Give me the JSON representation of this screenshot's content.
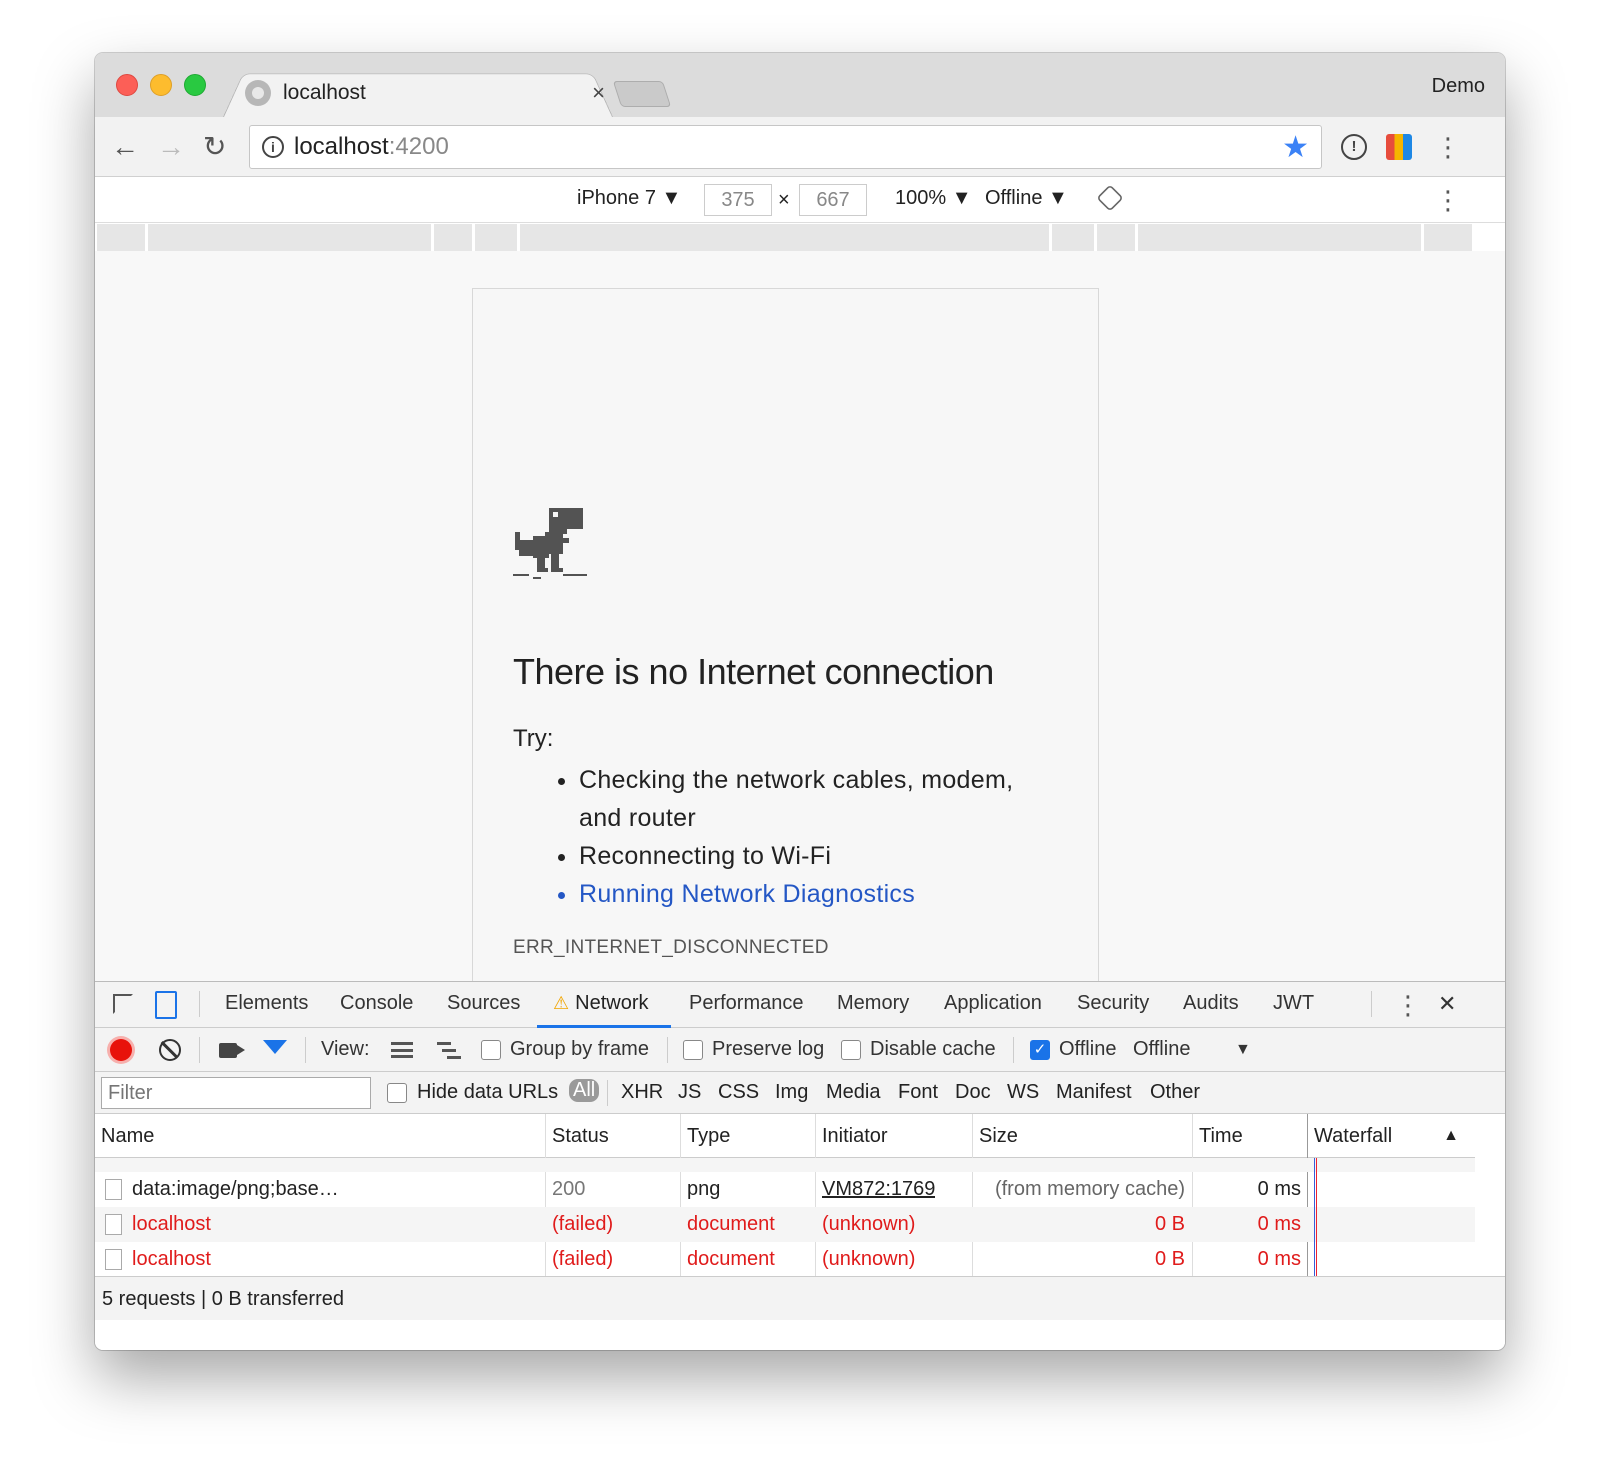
{
  "browser": {
    "tab_title": "localhost",
    "tab_close": "×",
    "profile": "Demo",
    "url_host": "localhost",
    "url_port": ":4200",
    "back_glyph": "←",
    "forward_glyph": "→",
    "reload_glyph": "↻",
    "star_glyph": "★",
    "ext_glyph": "!",
    "menu_glyph": "⋮",
    "icons": [
      "back-arrow-icon",
      "forward-arrow-icon",
      "reload-icon",
      "info-icon",
      "bookmark-star-icon",
      "extension-icon",
      "lighthouse-icon",
      "more-vert-icon"
    ]
  },
  "device_toolbar": {
    "device": "iPhone 7 ▼",
    "width": "375",
    "times": "×",
    "height": "667",
    "zoom": "100% ▼",
    "throttle": "Offline ▼",
    "menu_glyph": "⋮"
  },
  "page": {
    "title": "There is no Internet connection",
    "try_label": "Try:",
    "suggestions": [
      "Checking the network cables, modem, and router",
      "Reconnecting to Wi-Fi",
      "Running Network Diagnostics"
    ],
    "error_code": "ERR_INTERNET_DISCONNECTED"
  },
  "devtools": {
    "tabs": [
      "Elements",
      "Console",
      "Sources",
      "Network",
      "Performance",
      "Memory",
      "Application",
      "Security",
      "Audits",
      "JWT"
    ],
    "warning_glyph": "⚠",
    "menu_glyph": "⋮",
    "close_glyph": "✕",
    "toolbar": {
      "view_label": "View:",
      "group_by_frame": "Group by frame",
      "preserve_log": "Preserve log",
      "disable_cache": "Disable cache",
      "offline_label": "Offline",
      "throttle_value": "Offline",
      "throttle_arrow": "▼",
      "check_glyph": "✓",
      "offline_checked": true
    },
    "filter": {
      "placeholder": "Filter",
      "hide_data_urls": "Hide data URLs",
      "types": [
        "All",
        "XHR",
        "JS",
        "CSS",
        "Img",
        "Media",
        "Font",
        "Doc",
        "WS",
        "Manifest",
        "Other"
      ]
    },
    "columns": [
      "Name",
      "Status",
      "Type",
      "Initiator",
      "Size",
      "Time",
      "Waterfall"
    ],
    "sort_glyph": "▲",
    "rows": [
      {
        "name": "data:image/png;base…",
        "status": "200",
        "type": "png",
        "initiator": "VM872:1769",
        "size": "(from memory cache)",
        "time": "0 ms",
        "failed": false
      },
      {
        "name": "localhost",
        "status": "(failed)",
        "type": "document",
        "initiator": "(unknown)",
        "size": "0 B",
        "time": "0 ms",
        "failed": true
      },
      {
        "name": "localhost",
        "status": "(failed)",
        "type": "document",
        "initiator": "(unknown)",
        "size": "0 B",
        "time": "0 ms",
        "failed": true
      }
    ],
    "status_bar": "5 requests | 0 B transferred"
  },
  "colors": {
    "accent": "#1a73e8",
    "error": "#e01b1b",
    "link": "#2457c5",
    "record": "#e8120b"
  }
}
